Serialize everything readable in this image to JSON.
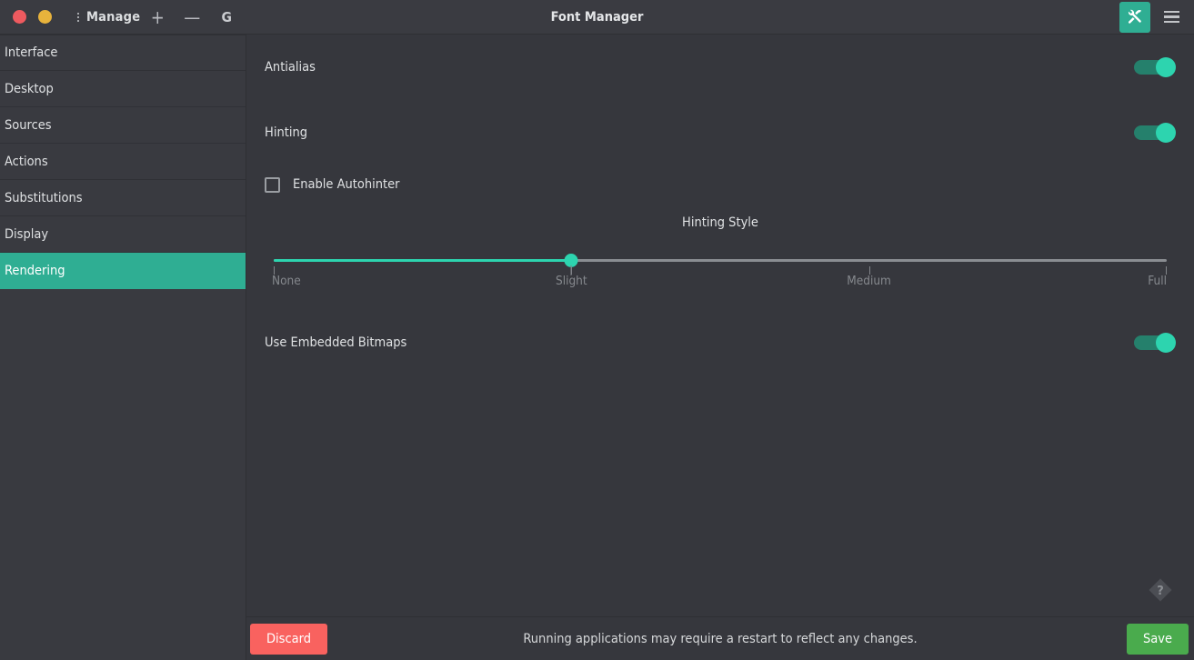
{
  "window": {
    "title": "Font Manager",
    "controls": {
      "close_icon": "close-circle-icon",
      "minimize_icon": "minimize-circle-icon"
    },
    "toolbar_left": {
      "kebab_icon": "vertical-dots-icon",
      "manage_label": "Manage",
      "add_label": "+",
      "remove_label": "—",
      "google_fonts_label": "G"
    },
    "toolbar_right": {
      "tools_icon": "tools-icon",
      "menu_icon": "hamburger-menu-icon"
    }
  },
  "sidebar": {
    "items": [
      {
        "label": "Interface",
        "active": false
      },
      {
        "label": "Desktop",
        "active": false
      },
      {
        "label": "Sources",
        "active": false
      },
      {
        "label": "Actions",
        "active": false
      },
      {
        "label": "Substitutions",
        "active": false
      },
      {
        "label": "Display",
        "active": false
      },
      {
        "label": "Rendering",
        "active": true
      }
    ]
  },
  "main": {
    "settings": [
      {
        "label": "Antialias",
        "value": "on"
      },
      {
        "label": "Hinting",
        "value": "on"
      }
    ],
    "autohinter": {
      "label": "Enable Autohinter",
      "checked": false
    },
    "hinting_style": {
      "title": "Hinting Style",
      "options": [
        "None",
        "Slight",
        "Medium",
        "Full"
      ],
      "selected": "Slight",
      "selected_index": 1
    },
    "embedded_bitmaps": {
      "label": "Use Embedded Bitmaps",
      "value": "on"
    },
    "help_icon": "help-diamond-icon"
  },
  "bottombar": {
    "discard_label": "Discard",
    "status_message": "Running applications may require a restart to reflect any changes.",
    "save_label": "Save"
  },
  "colors": {
    "accent_teal": "#2fae93",
    "toggle_knob": "#2dd4af",
    "toggle_track": "#25806c",
    "discard_red": "#f9625f",
    "save_green": "#4aab4d",
    "window_bg": "#36373d",
    "sidebar_bg": "#393a40",
    "titlebar_bg": "#3a3b41",
    "close_dot": "#ee5a5f",
    "min_dot": "#e8b33c"
  }
}
